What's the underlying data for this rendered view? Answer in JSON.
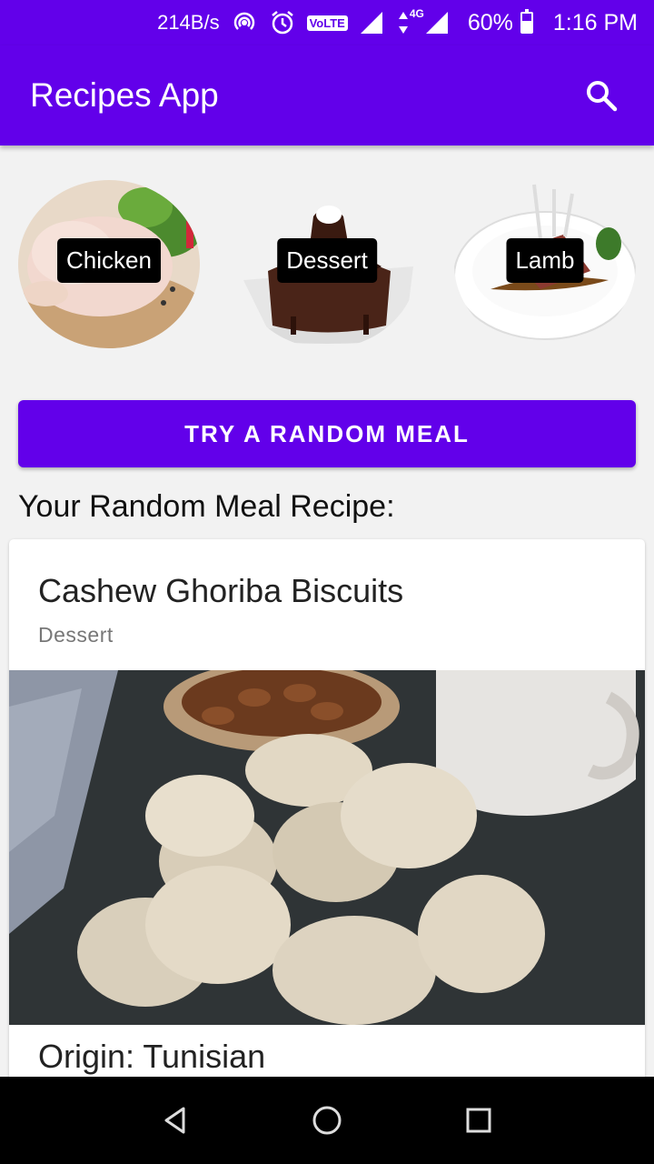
{
  "status_bar": {
    "net_speed": "214B/s",
    "network_type": "4G",
    "volte": "VoLTE",
    "battery": "60%",
    "time": "1:16 PM"
  },
  "app_bar": {
    "title": "Recipes App",
    "search_icon": "search-icon"
  },
  "categories": [
    {
      "label": "Chicken"
    },
    {
      "label": "Dessert"
    },
    {
      "label": "Lamb"
    }
  ],
  "random_button": {
    "label": "TRY A RANDOM MEAL"
  },
  "section_heading": "Your Random Meal Recipe:",
  "meal": {
    "name": "Cashew Ghoriba Biscuits",
    "category": "Dessert",
    "origin": "Origin: Tunisian"
  },
  "nav": {
    "back_icon": "back-triangle-icon",
    "home_icon": "home-circle-icon",
    "recents_icon": "recents-square-icon"
  },
  "colors": {
    "primary": "#6200ea",
    "background": "#f2f2f2"
  }
}
